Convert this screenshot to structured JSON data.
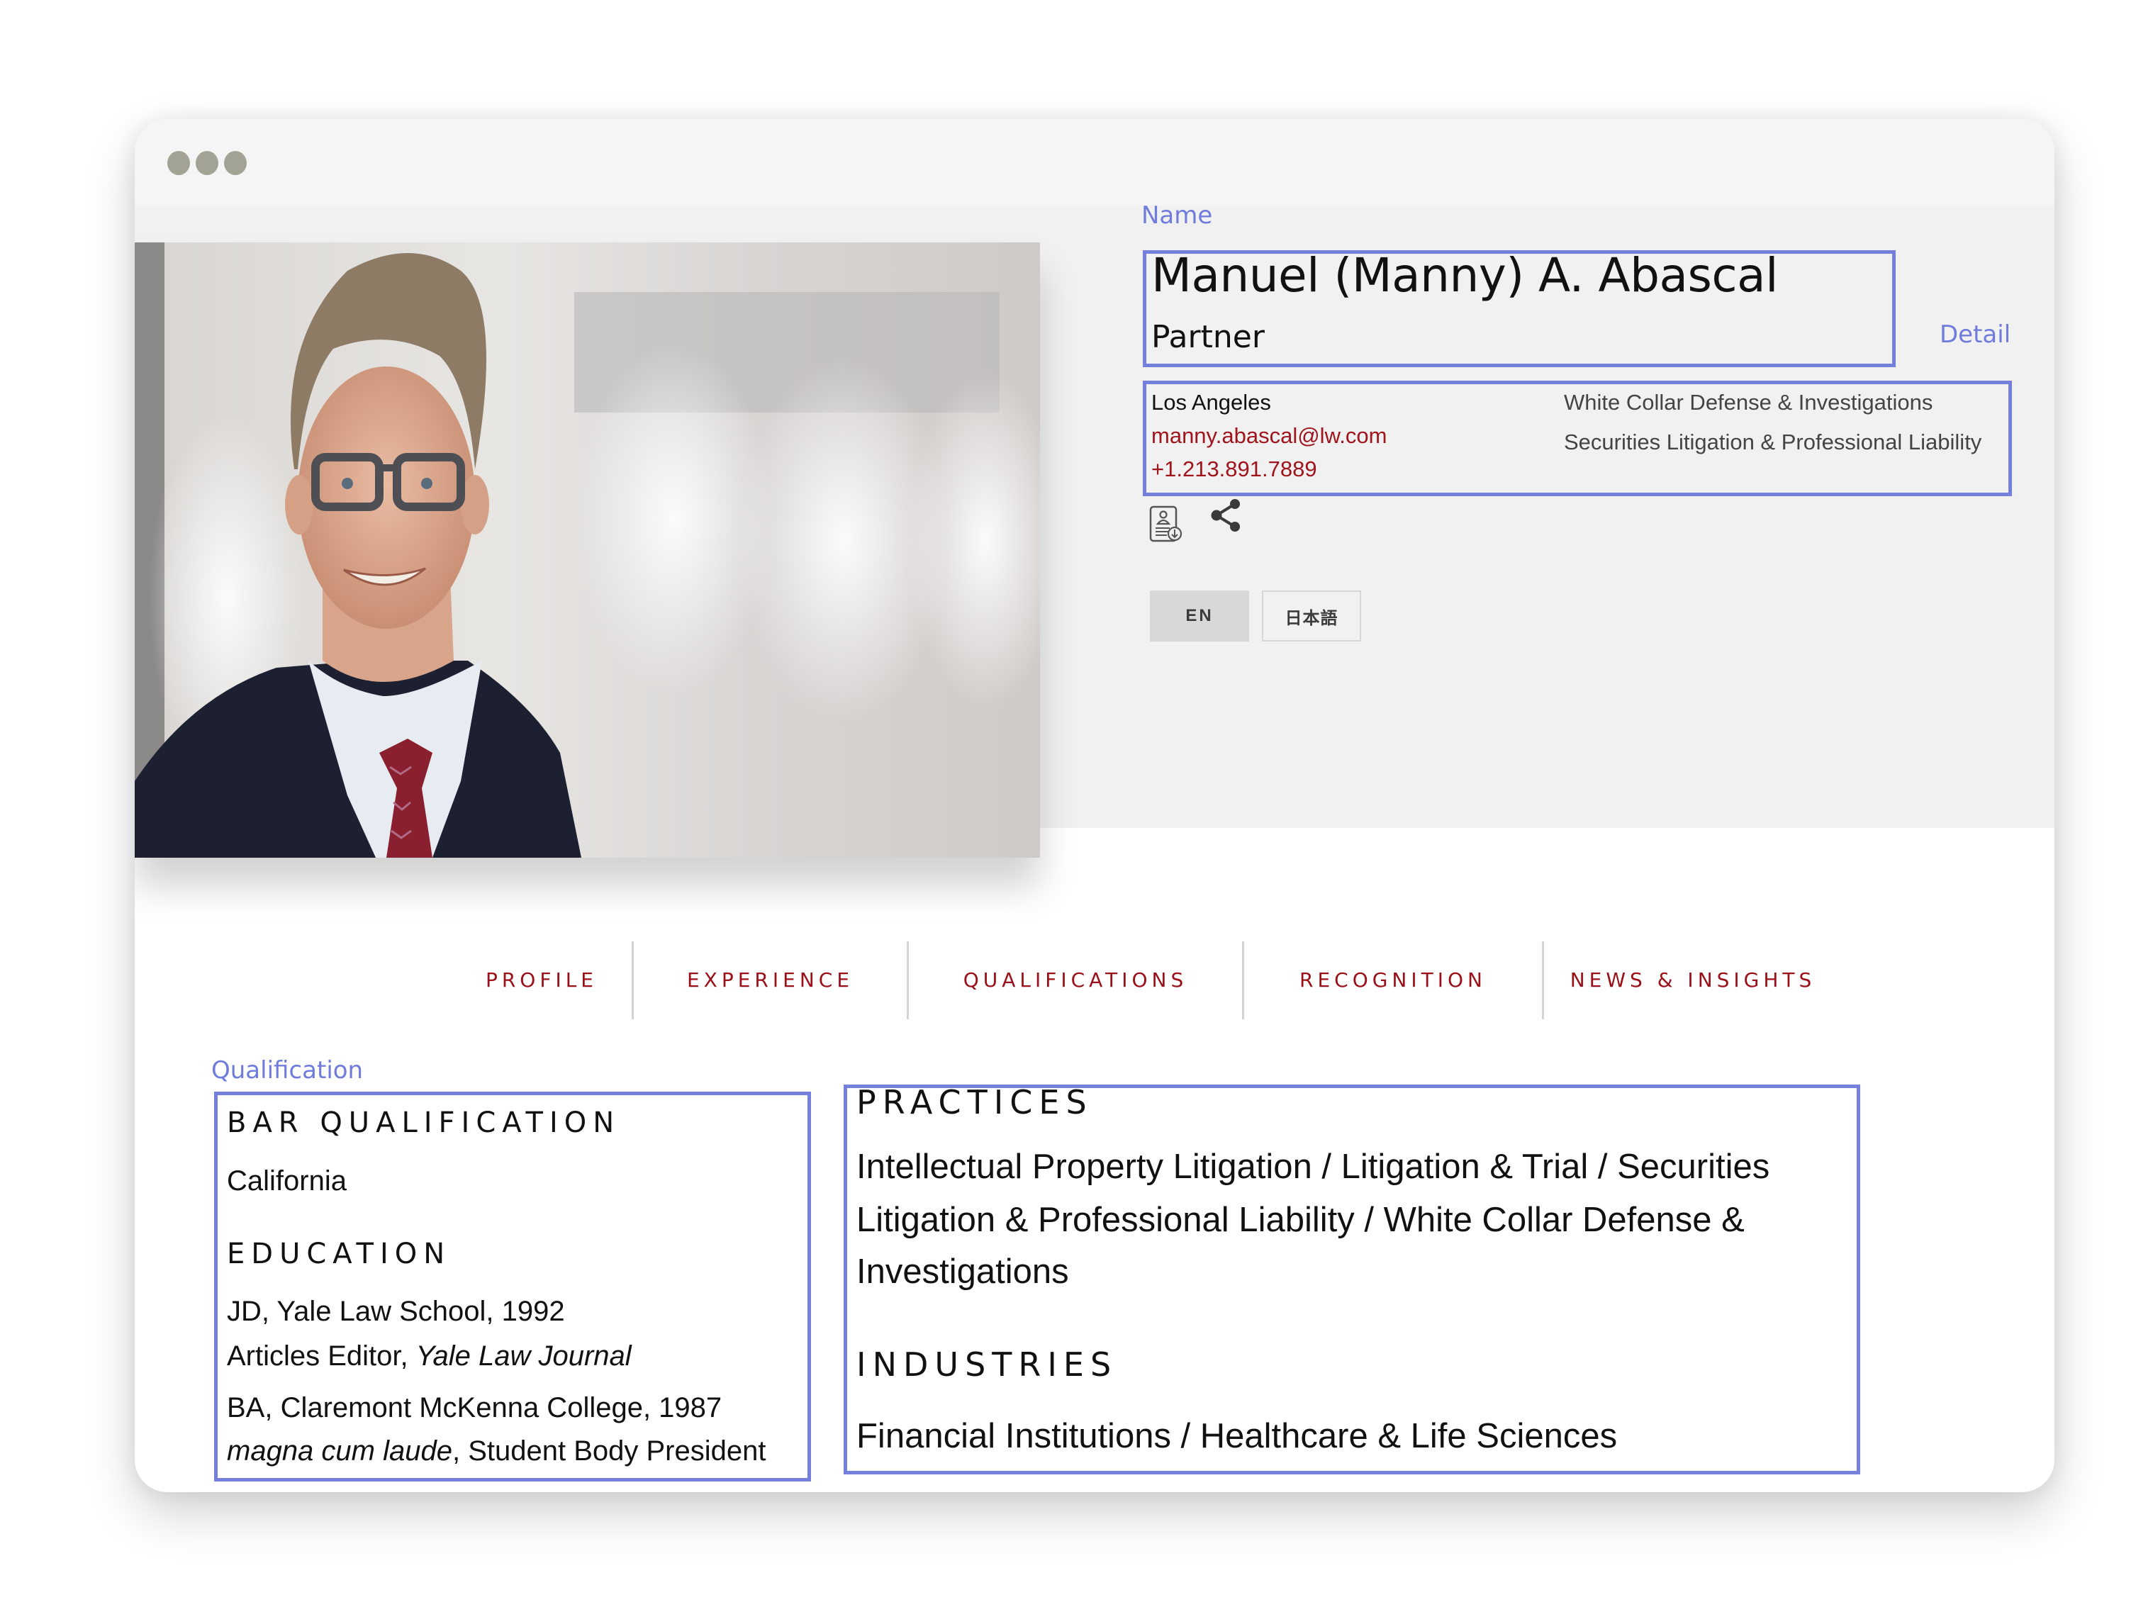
{
  "window": {
    "controls": [
      "dot-1",
      "dot-2",
      "dot-3"
    ]
  },
  "annotations": {
    "name": "Name",
    "detail": "Detail",
    "qualification": "Qualification"
  },
  "profile": {
    "photo_alt": "Portrait of Manuel (Manny) A. Abascal",
    "name": "Manuel (Manny) A. Abascal",
    "title": "Partner",
    "location": "Los Angeles",
    "email": "manny.abascal@lw.com",
    "phone": "+1.213.891.7889",
    "practice_links": [
      "White Collar Defense & Investigations",
      "Securities Litigation & Professional Liability"
    ]
  },
  "actions": {
    "vcard_icon": "contact-card-download-icon",
    "share_icon": "share-icon"
  },
  "languages": {
    "options": [
      "EN",
      "日本語"
    ],
    "selected": "EN"
  },
  "tabs": [
    {
      "label": "PROFILE"
    },
    {
      "label": "EXPERIENCE"
    },
    {
      "label": "QUALIFICATIONS"
    },
    {
      "label": "RECOGNITION"
    },
    {
      "label": "NEWS & INSIGHTS"
    }
  ],
  "qualifications": {
    "bar_heading": "BAR QUALIFICATION",
    "bar": "California",
    "education_heading": "EDUCATION",
    "education": [
      {
        "degree": "JD, Yale Law School, 1992",
        "note_prefix": "Articles Editor, ",
        "note_italic": "Yale Law Journal",
        "note_suffix": ""
      },
      {
        "degree": "BA, Claremont McKenna College, 1987",
        "note_prefix": "",
        "note_italic": "magna cum laude",
        "note_suffix": ", Student Body President"
      }
    ]
  },
  "practices": {
    "heading": "PRACTICES",
    "items": [
      "Intellectual Property Litigation",
      "Litigation & Trial",
      "Securities Litigation & Professional Liability",
      "White Collar Defense & Investigations"
    ],
    "separator": "/",
    "display_lines": [
      "Intellectual Property Litigation  /  Litigation & Trial  /  Securities",
      "Litigation & Professional Liability  /  White Collar Defense &",
      "Investigations"
    ]
  },
  "industries": {
    "heading": "INDUSTRIES",
    "items": [
      "Financial Institutions",
      "Healthcare & Life Sciences"
    ],
    "display_line": "Financial Institutions  /  Healthcare & Life Sciences"
  },
  "colors": {
    "annotation": "#7580dd",
    "brand_red": "#9b0f18",
    "hero_bg": "#f1f1f1",
    "window_dots": "#a2a394"
  }
}
